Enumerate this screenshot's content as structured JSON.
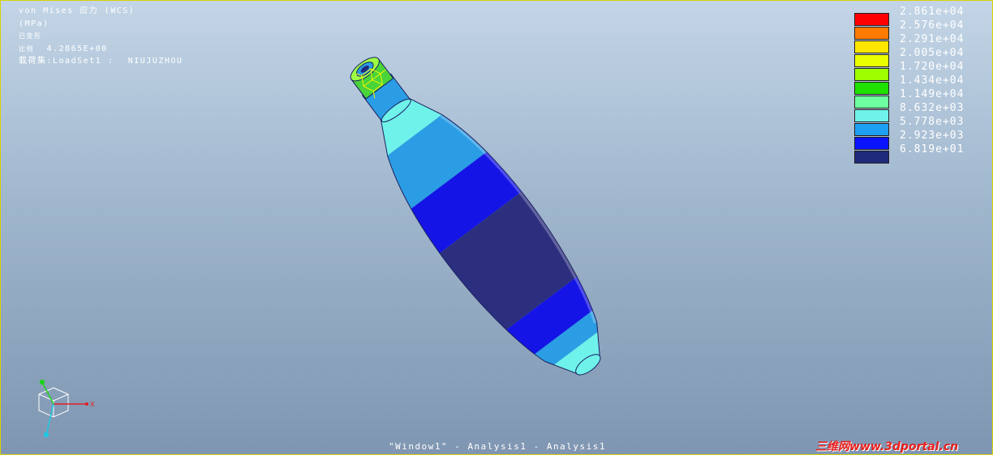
{
  "viewport": {
    "result_title": "von Mises 应力 (WCS)",
    "units": "(MPa)",
    "deformed_label": "已变形",
    "scale_label": "比例",
    "scale_value": "4.2865E+00",
    "loadset_label": "载荷集:LoadSet1 :",
    "model_name": "NIUJUZHOU",
    "window_title": "\"Window1\" - Analysis1 - Analysis1",
    "watermark": "三维网www.3dportal.cn"
  },
  "legend": {
    "entries": [
      {
        "value": "2.861e+04",
        "color": "#ff0000"
      },
      {
        "value": "2.576e+04",
        "color": "#ff7a00"
      },
      {
        "value": "2.291e+04",
        "color": "#ffe600"
      },
      {
        "value": "2.005e+04",
        "color": "#eaff00"
      },
      {
        "value": "1.720e+04",
        "color": "#9dff00"
      },
      {
        "value": "1.434e+04",
        "color": "#1fe000"
      },
      {
        "value": "1.149e+04",
        "color": "#6effa0"
      },
      {
        "value": "8.632e+03",
        "color": "#6ff2ea"
      },
      {
        "value": "5.778e+03",
        "color": "#1da0f2"
      },
      {
        "value": "2.923e+03",
        "color": "#0a14ff"
      },
      {
        "value": "6.819e+01",
        "color": "#1f2a7a"
      }
    ]
  },
  "triad": {
    "x_label": "X"
  }
}
